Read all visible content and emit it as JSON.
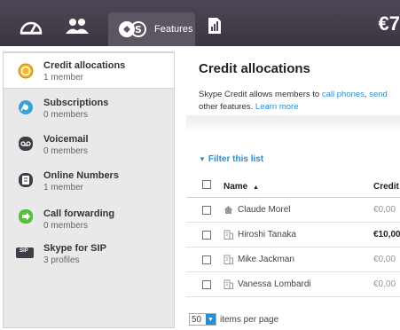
{
  "topbar": {
    "nav": [
      {
        "icon": "dashboard-icon"
      },
      {
        "icon": "people-icon"
      },
      {
        "icon": "features-icon",
        "label": "Features"
      },
      {
        "icon": "reports-icon"
      }
    ],
    "balance": "€7"
  },
  "sidebar": {
    "items": [
      {
        "title": "Credit allocations",
        "sub": "1 member",
        "icon": "credit-icon",
        "color": "#f1b623"
      },
      {
        "title": "Subscriptions",
        "sub": "0 members",
        "icon": "subscriptions-icon",
        "color": "#3aa0d8"
      },
      {
        "title": "Voicemail",
        "sub": "0 members",
        "icon": "voicemail-icon",
        "color": "#3e3e48"
      },
      {
        "title": "Online Numbers",
        "sub": "1 member",
        "icon": "online-numbers-icon",
        "color": "#3e3e48"
      },
      {
        "title": "Call forwarding",
        "sub": "0 members",
        "icon": "call-forwarding-icon",
        "color": "#55c13b"
      },
      {
        "title": "Skype for SIP",
        "sub": "3 profiles",
        "icon": "sip-icon",
        "color": "#3e3e48",
        "badge": "SIP"
      }
    ]
  },
  "main": {
    "title": "Credit allocations",
    "desc_prefix": "Skype Credit allows members to ",
    "desc_link1": "call phones",
    "desc_sep": ", ",
    "desc_link2": "send",
    "desc_line2": "other features. ",
    "desc_link3": "Learn more",
    "filter": "Filter this list",
    "table": {
      "col_name": "Name",
      "col_credit": "Credit",
      "sort_indicator": "▲",
      "rows": [
        {
          "name": "Claude Morel",
          "amount": "€0,00",
          "icon": "home-icon",
          "bold": false
        },
        {
          "name": "Hiroshi Tanaka",
          "amount": "€10,00",
          "icon": "building-icon",
          "bold": true
        },
        {
          "name": "Mike Jackman",
          "amount": "€0,00",
          "icon": "building-icon",
          "bold": false
        },
        {
          "name": "Vanessa Lombardi",
          "amount": "€0,00",
          "icon": "building-icon",
          "bold": false
        }
      ]
    },
    "per_page_value": "50",
    "per_page_label": "items per page"
  }
}
